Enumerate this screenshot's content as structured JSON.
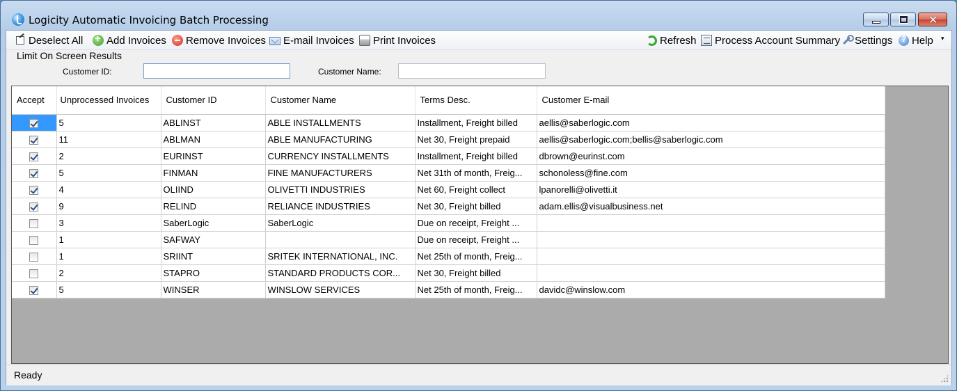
{
  "window": {
    "title": "Logicity Automatic Invoicing Batch Processing",
    "controls": {
      "minimize": "",
      "maximize": "",
      "close": "✕"
    }
  },
  "toolbar": {
    "left": [
      {
        "label": "Deselect All",
        "icon": "deselect-icon"
      },
      {
        "label": "Add Invoices",
        "icon": "add-icon"
      },
      {
        "label": "Remove Invoices",
        "icon": "remove-icon"
      },
      {
        "label": "E-mail Invoices",
        "icon": "email-icon"
      },
      {
        "label": "Print Invoices",
        "icon": "print-icon"
      }
    ],
    "right": [
      {
        "label": "Refresh",
        "icon": "refresh-icon"
      },
      {
        "label": "Process Account Summary",
        "icon": "summary-icon"
      },
      {
        "label": "Settings",
        "icon": "settings-icon"
      },
      {
        "label": "Help",
        "icon": "help-icon"
      }
    ],
    "overflow": "▾"
  },
  "filter": {
    "legend": "Limit On Screen Results",
    "customer_id_label": "Customer ID:",
    "customer_id_value": "",
    "customer_name_label": "Customer Name:",
    "customer_name_value": ""
  },
  "grid": {
    "columns": [
      "Accept",
      "Unprocessed Invoices",
      "Customer ID",
      "Customer Name",
      "Terms Desc.",
      "Customer E-mail"
    ],
    "rows": [
      {
        "accept": true,
        "invoices": "5",
        "customer_id": "ABLINST",
        "customer_name": "ABLE INSTALLMENTS",
        "terms": "Installment, Freight billed",
        "email": "aellis@saberlogic.com"
      },
      {
        "accept": true,
        "invoices": "11",
        "customer_id": "ABLMAN",
        "customer_name": "ABLE MANUFACTURING",
        "terms": "Net 30, Freight prepaid",
        "email": "aellis@saberlogic.com;bellis@saberlogic.com"
      },
      {
        "accept": true,
        "invoices": "2",
        "customer_id": "EURINST",
        "customer_name": "CURRENCY INSTALLMENTS",
        "terms": "Installment, Freight billed",
        "email": "dbrown@eurinst.com"
      },
      {
        "accept": true,
        "invoices": "5",
        "customer_id": "FINMAN",
        "customer_name": "FINE MANUFACTURERS",
        "terms": "Net 31th of month, Freig...",
        "email": "schonoless@fine.com"
      },
      {
        "accept": true,
        "invoices": "4",
        "customer_id": "OLIIND",
        "customer_name": "OLIVETTI INDUSTRIES",
        "terms": "Net 60, Freight collect",
        "email": "lpanorelli@olivetti.it"
      },
      {
        "accept": true,
        "invoices": "9",
        "customer_id": "RELIND",
        "customer_name": "RELIANCE INDUSTRIES",
        "terms": "Net 30, Freight billed",
        "email": "adam.ellis@visualbusiness.net"
      },
      {
        "accept": false,
        "invoices": "3",
        "customer_id": "SaberLogic",
        "customer_name": "SaberLogic",
        "terms": "Due on receipt, Freight ...",
        "email": ""
      },
      {
        "accept": false,
        "invoices": "1",
        "customer_id": "SAFWAY",
        "customer_name": "",
        "terms": "Due on receipt, Freight ...",
        "email": ""
      },
      {
        "accept": false,
        "invoices": "1",
        "customer_id": "SRIINT",
        "customer_name": "SRITEK INTERNATIONAL, INC.",
        "terms": "Net 25th of month, Freig...",
        "email": ""
      },
      {
        "accept": false,
        "invoices": "2",
        "customer_id": "STAPRO",
        "customer_name": "STANDARD PRODUCTS COR...",
        "terms": "Net 30, Freight billed",
        "email": ""
      },
      {
        "accept": true,
        "invoices": "5",
        "customer_id": "WINSER",
        "customer_name": "WINSLOW SERVICES",
        "terms": "Net 25th of month, Freig...",
        "email": "davidc@winslow.com"
      }
    ]
  },
  "status": {
    "text": "Ready"
  },
  "colors": {
    "selection": "#3399ff",
    "grid_background": "#ababab",
    "title_gradient_top": "#c9dcf0"
  }
}
